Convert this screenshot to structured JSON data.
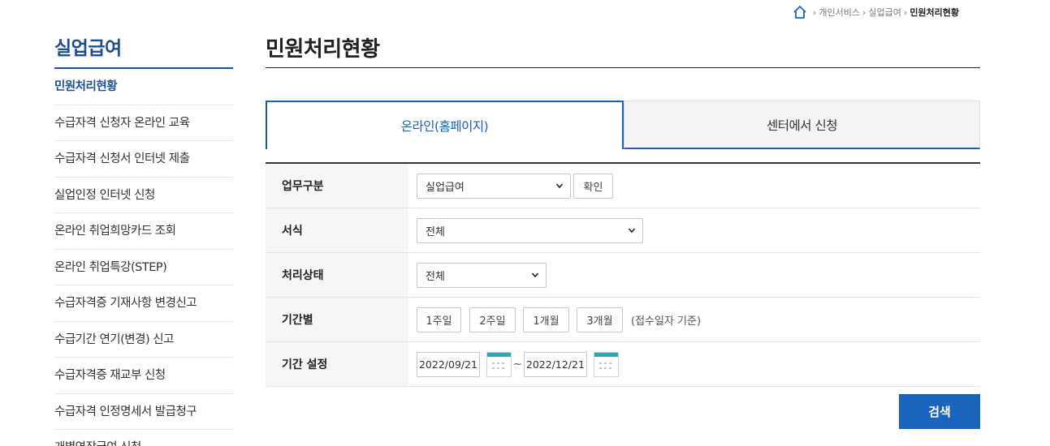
{
  "breadcrumb": {
    "items": [
      "개인서비스",
      "실업급여"
    ],
    "current": "민원처리현황"
  },
  "sidebar": {
    "title": "실업급여",
    "items": [
      {
        "label": "민원처리현황",
        "active": true
      },
      {
        "label": "수급자격 신청자 온라인 교육"
      },
      {
        "label": "수급자격 신청서 인터넷 제출"
      },
      {
        "label": "실업인정 인터넷 신청"
      },
      {
        "label": "온라인 취업희망카드 조회"
      },
      {
        "label": "온라인 취업특강(STEP)"
      },
      {
        "label": "수급자격증 기재사항 변경신고"
      },
      {
        "label": "수급기간 연기(변경) 신고"
      },
      {
        "label": "수급자격증 재교부 신청"
      },
      {
        "label": "수급자격 인정명세서 발급청구"
      },
      {
        "label": "개별연장급여 신청"
      }
    ]
  },
  "main": {
    "title": "민원처리현황",
    "tabs": [
      {
        "label": "온라인(홈페이지)",
        "active": true
      },
      {
        "label": "센터에서 신청",
        "active": false
      }
    ],
    "form": {
      "work_type": {
        "label": "업무구분",
        "value": "실업급여",
        "confirm": "확인"
      },
      "format": {
        "label": "서식",
        "value": "전체"
      },
      "status": {
        "label": "처리상태",
        "value": "전체"
      },
      "period": {
        "label": "기간별",
        "options": [
          "1주일",
          "2주일",
          "1개월",
          "3개월"
        ],
        "note": "(접수일자 기준)"
      },
      "date_range": {
        "label": "기간 설정",
        "start": "2022/09/21",
        "separator": "~",
        "end": "2022/12/21"
      }
    },
    "search_label": "검색"
  },
  "colors": {
    "accent": "#1a5fb4",
    "title": "#1f4f8f",
    "calendar": "#26a9b5"
  }
}
